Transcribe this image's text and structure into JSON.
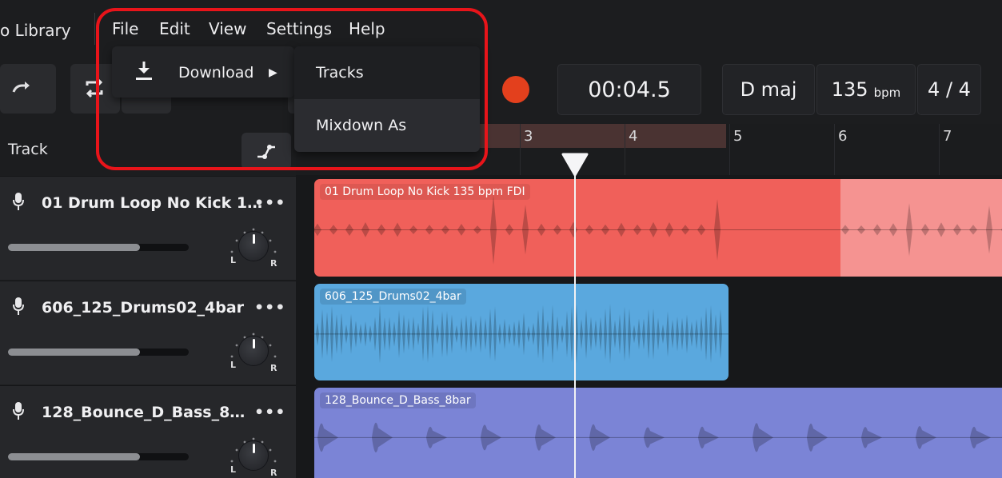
{
  "app": {
    "library_label": "o Library"
  },
  "menubar": {
    "items": [
      {
        "label": "File"
      },
      {
        "label": "Edit"
      },
      {
        "label": "View"
      },
      {
        "label": "Settings"
      },
      {
        "label": "Help"
      }
    ]
  },
  "file_menu": {
    "download": {
      "label": "Download",
      "icon": "download-icon",
      "arrow": "▶"
    },
    "download_submenu": [
      {
        "label": "Tracks"
      },
      {
        "label": "Mixdown As"
      }
    ]
  },
  "transport": {
    "time": "00:04.5",
    "key": "D maj",
    "tempo_value": "135",
    "tempo_unit": "bpm",
    "time_signature": "4 / 4",
    "record_color": "#e3401d"
  },
  "track_list": {
    "column_label": "Track"
  },
  "ruler": {
    "bar_numbers": [
      "3",
      "4",
      "5",
      "6",
      "7"
    ]
  },
  "tracks": [
    {
      "name": "01 Drum Loop No Kick 1…",
      "more": "•••",
      "volume": 0.73,
      "pan_left": "L",
      "pan_right": "R",
      "clip_label": "01 Drum Loop No Kick 135 bpm FDI",
      "color": "#f0605a"
    },
    {
      "name": "606_125_Drums02_4bar",
      "more": "•••",
      "volume": 0.73,
      "pan_left": "L",
      "pan_right": "R",
      "clip_label": "606_125_Drums02_4bar",
      "color": "#5aa8de"
    },
    {
      "name": "128_Bounce_D_Bass_8…",
      "more": "•••",
      "volume": 0.73,
      "pan_left": "L",
      "pan_right": "R",
      "clip_label": "128_Bounce_D_Bass_8bar",
      "color": "#7b84d6"
    }
  ]
}
